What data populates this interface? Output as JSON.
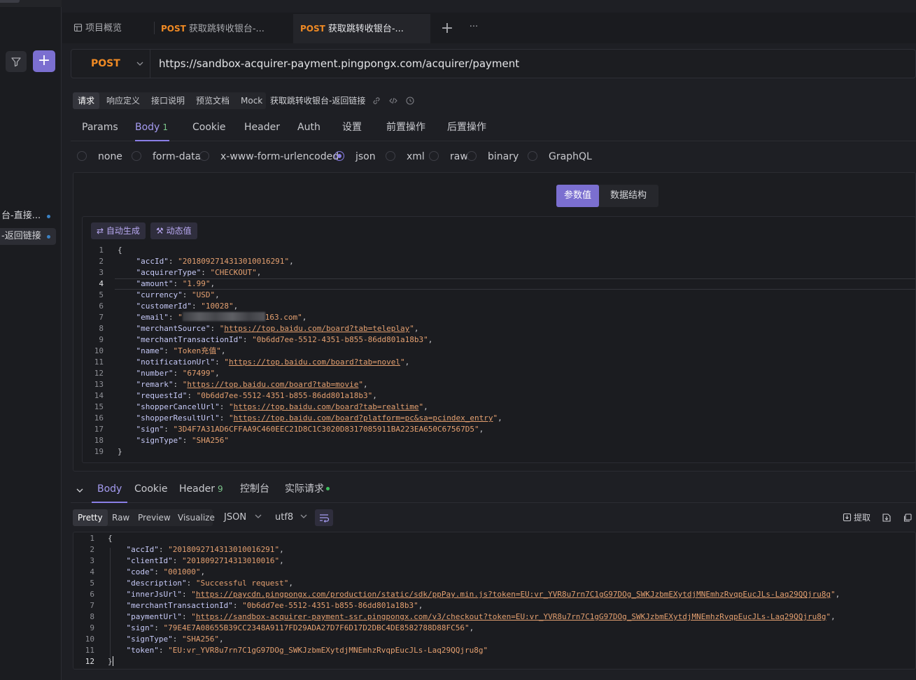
{
  "sidebar": {
    "items": [
      {
        "label": "台-直接..."
      },
      {
        "label": "-返回链接"
      }
    ],
    "add_label": "+"
  },
  "tabs": [
    {
      "method": "",
      "label": "项目概览"
    },
    {
      "method": "POST",
      "label": "获取跳转收银台-..."
    },
    {
      "method": "POST",
      "label": "获取跳转收银台-..."
    }
  ],
  "tabbar": {
    "add_label": "+",
    "more_label": "···"
  },
  "request": {
    "method": "POST",
    "url": "https://sandbox-acquirer-payment.pingpongx.com/acquirer/payment",
    "name": "获取跳转收银台-返回链接"
  },
  "subtabs": [
    "请求",
    "响应定义",
    "接口说明",
    "预览文档",
    "Mock"
  ],
  "request_tabs": [
    {
      "label": "Params"
    },
    {
      "label": "Body",
      "badge": "1"
    },
    {
      "label": "Cookie"
    },
    {
      "label": "Header"
    },
    {
      "label": "Auth"
    },
    {
      "label": "设置"
    },
    {
      "label": "前置操作"
    },
    {
      "label": "后置操作"
    }
  ],
  "body_types": [
    "none",
    "form-data",
    "x-www-form-urlencoded",
    "json",
    "xml",
    "raw",
    "binary",
    "GraphQL"
  ],
  "body_selected": "json",
  "view_toggle": [
    "参数值",
    "数据结构"
  ],
  "editor_toolbar": {
    "auto_generate": "自动生成",
    "dynamic_value": "动态值"
  },
  "request_body": [
    {
      "t": "{"
    },
    {
      "k": "accId",
      "v": "2018092714313010016291"
    },
    {
      "k": "acquirerType",
      "v": "CHECKOUT"
    },
    {
      "k": "amount",
      "v": "1.99"
    },
    {
      "k": "currency",
      "v": "USD"
    },
    {
      "k": "customerId",
      "v": "10028"
    },
    {
      "k": "email",
      "v": "163.com",
      "redacted": true
    },
    {
      "k": "merchantSource",
      "v": "https://top.baidu.com/board?tab=teleplay",
      "url": true
    },
    {
      "k": "merchantTransactionId",
      "v": "0b6dd7ee-5512-4351-b855-86dd801a18b3"
    },
    {
      "k": "name",
      "v": "Token充值"
    },
    {
      "k": "notificationUrl",
      "v": "https://top.baidu.com/board?tab=novel",
      "url": true
    },
    {
      "k": "number",
      "v": "67499"
    },
    {
      "k": "remark",
      "v": "https://top.baidu.com/board?tab=movie",
      "url": true
    },
    {
      "k": "requestId",
      "v": "0b6dd7ee-5512-4351-b855-86dd801a18b3"
    },
    {
      "k": "shopperCancelUrl",
      "v": "https://top.baidu.com/board?tab=realtime",
      "url": true
    },
    {
      "k": "shopperResultUrl",
      "v": "https://top.baidu.com/board?platform=pc&sa=pcindex_entry",
      "url": true
    },
    {
      "k": "sign",
      "v": "3D4F7A31AD6CFFAA9C460EEC21D8C1C3020D8317085911BA223EA650C67567D5"
    },
    {
      "k": "signType",
      "v": "SHA256",
      "last": true
    },
    {
      "t": "}"
    }
  ],
  "response_tabs": [
    {
      "label": "Body"
    },
    {
      "label": "Cookie"
    },
    {
      "label": "Header",
      "badge": "9"
    },
    {
      "label": "控制台"
    },
    {
      "label": "实际请求"
    }
  ],
  "response_tools": {
    "views": [
      "Pretty",
      "Raw",
      "Preview",
      "Visualize"
    ],
    "format": "JSON",
    "encoding": "utf8",
    "extract": "提取"
  },
  "response_body": [
    {
      "t": "{"
    },
    {
      "k": "accId",
      "v": "2018092714313010016291"
    },
    {
      "k": "clientId",
      "v": "2018092714313010016"
    },
    {
      "k": "code",
      "v": "001000"
    },
    {
      "k": "description",
      "v": "Successful request"
    },
    {
      "k": "innerJsUrl",
      "v": "https://paycdn.pingpongx.com/production/static/sdk/ppPay.min.js?token=EU:vr_YVR8u7rn7C1gG97DOg_SWKJzbmEXytdjMNEmhzRvqpEucJLs-Laq29QQjru8g",
      "url": true
    },
    {
      "k": "merchantTransactionId",
      "v": "0b6dd7ee-5512-4351-b855-86dd801a18b3"
    },
    {
      "k": "paymentUrl",
      "v": "https://sandbox-acquirer-payment-ssr.pingpongx.com/v3/checkout?token=EU:vr_YVR8u7rn7C1gG97DOg_SWKJzbmEXytdjMNEmhzRvqpEucJLs-Laq29QQjru8g",
      "url": true
    },
    {
      "k": "sign",
      "v": "79E4E7A08655B39CC2348A9117FD29ADA27D7F6D17D2DBC4DE8582788D88FC56"
    },
    {
      "k": "signType",
      "v": "SHA256"
    },
    {
      "k": "token",
      "v": "EU:vr_YVR8u7rn7C1gG97DOg_SWKJzbmEXytdjMNEmhzRvqpEucJLs-Laq29QQjru8g",
      "last": true
    },
    {
      "t": "}"
    }
  ],
  "colors": {
    "accent": "#7b6fd0",
    "method_post": "#f08a24",
    "string": "#e4a070",
    "key": "#c6c9f7"
  }
}
